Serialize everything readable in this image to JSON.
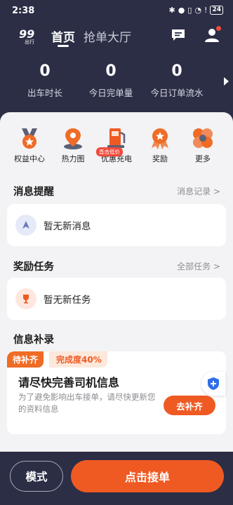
{
  "status_bar": {
    "time": "2:38",
    "battery": "24"
  },
  "header": {
    "logo_text": "99出行",
    "tab_home": "首页",
    "tab_hall": "抢单大厅"
  },
  "stats": [
    {
      "value": "0",
      "label": "出车时长"
    },
    {
      "value": "0",
      "label": "今日完单量"
    },
    {
      "value": "0",
      "label": "今日订单流水"
    }
  ],
  "grid": [
    {
      "label": "权益中心",
      "icon": "rights-badge-icon"
    },
    {
      "label": "热力图",
      "icon": "heatmap-pin-icon"
    },
    {
      "label": "优惠充电",
      "icon": "charging-station-icon",
      "badge": "直击低价"
    },
    {
      "label": "奖励",
      "icon": "reward-medal-icon"
    },
    {
      "label": "更多",
      "icon": "more-grid-icon"
    }
  ],
  "messages": {
    "title": "消息提醒",
    "link": "消息记录 >",
    "empty": "暂无新消息"
  },
  "rewards": {
    "title": "奖励任务",
    "link": "全部任务 >",
    "empty": "暂无新任务"
  },
  "info": {
    "title": "信息补录",
    "pending_tag": "待补齐",
    "completion": "完成度40%",
    "card_title": "请尽快完善司机信息",
    "card_desc": "为了避免影响出车接单，请尽快更新您的资料信息",
    "button": "去补齐"
  },
  "bottom": {
    "mode": "模式",
    "accept": "点击接单"
  },
  "colors": {
    "accent": "#ef5a23",
    "header_bg": "#2b2e45",
    "panel_bg": "#f3f3f5"
  }
}
